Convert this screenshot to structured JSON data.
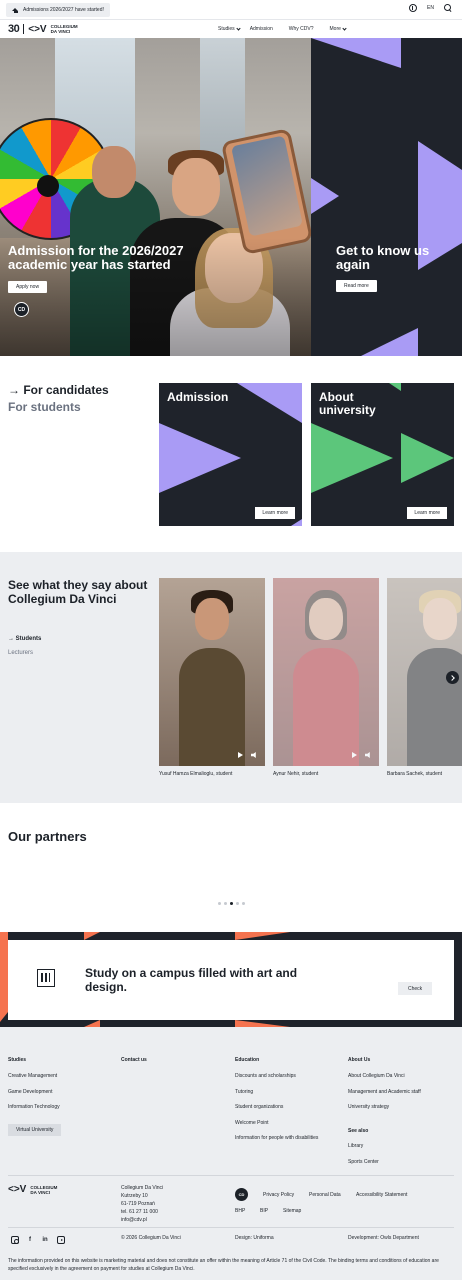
{
  "topbar": {
    "announcement": "Admissions 2026/2027 have started!",
    "language": "EN"
  },
  "header": {
    "logo_30": "30",
    "logo_cdv": "<>V",
    "logo_name_line1": "COLLEGIUM",
    "logo_name_line2": "DA VINCI",
    "nav": [
      "Studies",
      "Admission",
      "Why CDV?",
      "More"
    ]
  },
  "hero": {
    "left_title": "Admission for the 2026/2027 academic year has started",
    "left_button": "Apply now",
    "badge": "CD",
    "right_title": "Get to know us again",
    "right_button": "Read more"
  },
  "candidates": {
    "title": "→ For candidates",
    "subtitle": "For students",
    "tiles": [
      {
        "title": "Admission",
        "button": "Learn more"
      },
      {
        "title": "About university",
        "button": "Learn more"
      }
    ]
  },
  "testimonials": {
    "title": "See what they say about Collegium Da Vinci",
    "tab_active": "→ Students",
    "tab_inactive": "Lecturers",
    "videos": [
      {
        "caption": "Yusuf Hamza Elmalioglu, student"
      },
      {
        "caption": "Aynur Nehir, student"
      },
      {
        "caption": "Barbara Sachek, student"
      }
    ]
  },
  "partners": {
    "title": "Our partners"
  },
  "campus": {
    "text": "Study on a campus filled with art and design.",
    "button": "Check"
  },
  "footer": {
    "columns": [
      {
        "heading": "Studies",
        "links": [
          "Creative Management",
          "Game Development",
          "Information Technology"
        ],
        "button": "Virtual University"
      },
      {
        "heading": "Contact us",
        "links": []
      },
      {
        "heading": "Education",
        "links": [
          "Discounts and scholarships",
          "Tutoring",
          "Student organizations",
          "Welcome Point",
          "Information for people with disabilities"
        ]
      },
      {
        "heading": "About Us",
        "links": [
          "About Collegium Da Vinci",
          "Management and Academic staff",
          "University strategy"
        ],
        "see_also_heading": "See also",
        "see_also_links": [
          "Library",
          "Sports Center"
        ]
      }
    ],
    "address": [
      "Collegium Da Vinci",
      "Kutrzeby 10",
      "61-719 Poznań",
      "tel. 61 27 11 000",
      "info@cdv.pl"
    ],
    "badge": "CD",
    "legal_links": [
      "Privacy Policy",
      "Personal Data",
      "Accessibility Statement"
    ],
    "legal_links_2": [
      "BHP",
      "BIP",
      "Sitemap"
    ],
    "copyright": "© 2026 Collegium Da Vinci",
    "design": "Design: Uniforma",
    "development": "Development: Owls Department",
    "social": [
      "instagram",
      "facebook",
      "linkedin",
      "youtube"
    ],
    "disclaimer": "The information provided on this website is marketing material and does not constitute an offer within the meaning of Article 71 of the Civil Code. The binding terms and conditions of education are specified exclusively in the agreement on payment for studies at Collegium Da Vinci."
  },
  "colors": {
    "dark": "#1f232b",
    "purple": "#a99bf5",
    "green": "#5cc67b",
    "orange": "#f5734f",
    "light_bg": "#eceef1"
  }
}
